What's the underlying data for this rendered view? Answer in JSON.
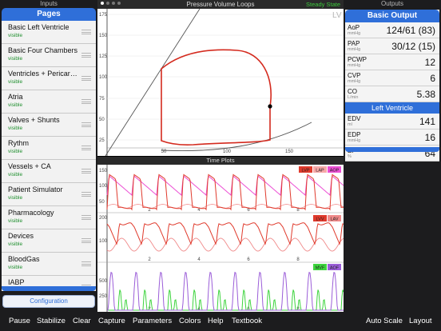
{
  "left": {
    "inputs_label": "Inputs",
    "title": "Pages",
    "items": [
      {
        "name": "Basic Left Ventricle",
        "status": "visible"
      },
      {
        "name": "Basic Four Chambers",
        "status": "visible"
      },
      {
        "name": "Ventricles + Pericard...",
        "status": "visible"
      },
      {
        "name": "Atria",
        "status": "visible"
      },
      {
        "name": "Valves + Shunts",
        "status": "visible"
      },
      {
        "name": "Rythm",
        "status": "visible"
      },
      {
        "name": "Vessels + CA",
        "status": "visible"
      },
      {
        "name": "Patient Simulator",
        "status": "visible"
      },
      {
        "name": "Pharmacology",
        "status": "visible"
      },
      {
        "name": "Devices",
        "status": "visible"
      },
      {
        "name": "BloodGas",
        "status": "visible"
      },
      {
        "name": "IABP",
        "status": ""
      }
    ],
    "config_label": "Configuration"
  },
  "center": {
    "pv_title": "Pressure Volume Loops",
    "steady": "Steady State",
    "lv_label": "LV",
    "pv_yticks": [
      "175",
      "150",
      "125",
      "100",
      "75",
      "50",
      "25"
    ],
    "pv_xticks": [
      "50",
      "100",
      "150"
    ],
    "tp_title": "Time Plots",
    "tp1_yticks": [
      "150",
      "100",
      "50"
    ],
    "tp1_legend": [
      {
        "label": "LVP",
        "color": "#e03a2c"
      },
      {
        "label": "LAP",
        "color": "#f7a8a8"
      },
      {
        "label": "AOP",
        "color": "#ec4fd4"
      }
    ],
    "tp2_yticks": [
      "200",
      "100"
    ],
    "tp2_legend": [
      {
        "label": "LVV",
        "color": "#e03a2c"
      },
      {
        "label": "LAV",
        "color": "#f08a8a"
      }
    ],
    "tp3_yticks": [
      "500",
      "250"
    ],
    "tp3_legend": [
      {
        "label": "MVF",
        "color": "#3ed43e"
      },
      {
        "label": "AOF",
        "color": "#9b5dd8"
      }
    ],
    "time_ticks": [
      "2",
      "4",
      "6",
      "8"
    ]
  },
  "right": {
    "outputs_label": "Outputs",
    "title": "Basic Output",
    "rows1": [
      {
        "label": "AoP",
        "unit": "mmHg",
        "value": "124/61 (83)"
      },
      {
        "label": "PAP",
        "unit": "mmHg",
        "value": "30/12 (15)"
      },
      {
        "label": "PCWP",
        "unit": "mmHg",
        "value": "12"
      },
      {
        "label": "CVP",
        "unit": "mmHg",
        "value": "6"
      },
      {
        "label": "CO",
        "unit": "L/min",
        "value": "5.38"
      }
    ],
    "section2": "Left Ventricle",
    "rows2": [
      {
        "label": "EDV",
        "unit": "ml",
        "value": "141"
      },
      {
        "label": "EDP",
        "unit": "mmHg",
        "value": "16"
      },
      {
        "label": "EF",
        "unit": "%",
        "value": "64"
      }
    ]
  },
  "toolbar": {
    "pause": "Pause",
    "stabilize": "Stabilize",
    "clear": "Clear",
    "capture": "Capture",
    "parameters": "Parameters",
    "colors": "Colors",
    "help": "Help",
    "textbook": "Textbook",
    "autoscale": "Auto Scale",
    "layout": "Layout"
  },
  "colors": {
    "accent": "#2f6fd9",
    "loop": "#d42a1e",
    "steady": "#3cc93c"
  }
}
